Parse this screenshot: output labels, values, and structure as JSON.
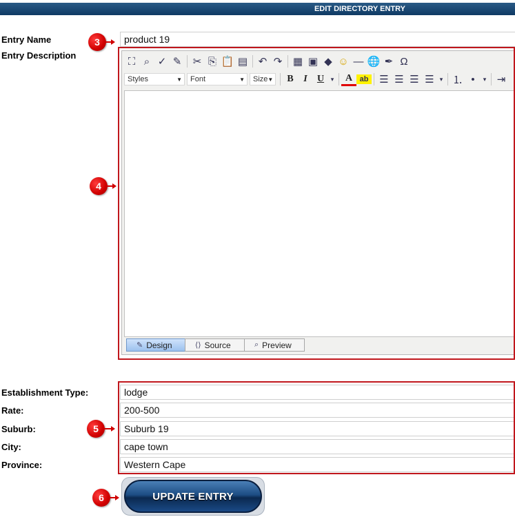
{
  "header": {
    "title": "EDIT DIRECTORY ENTRY"
  },
  "form": {
    "entry_name_label": "Entry Name",
    "entry_name_value": "product 19",
    "entry_description_label": "Entry Description",
    "establishment_type_label": "Establishment Type:",
    "establishment_type_value": "lodge",
    "rate_label": "Rate:",
    "rate_value": "200-500",
    "suburb_label": "Suburb:",
    "suburb_value": "Suburb 19",
    "city_label": "City:",
    "city_value": "cape town",
    "province_label": "Province:",
    "province_value": "Western Cape"
  },
  "editor": {
    "toolbar_row1_icons": [
      "fullscreen-icon",
      "find-icon",
      "spellcheck-icon",
      "clean-icon",
      "cut-icon",
      "copy-icon",
      "paste-icon",
      "paste-word-icon",
      "undo-icon",
      "redo-icon",
      "table-icon",
      "image-icon",
      "anchor-icon",
      "smiley-icon",
      "horizontal-rule-icon",
      "link-icon",
      "flash-icon",
      "special-char-icon"
    ],
    "styles_combo": "Styles",
    "font_combo": "Font",
    "size_combo": "Size",
    "bold": "B",
    "italic": "I",
    "underline": "U",
    "text_color": "A",
    "highlight": "ab",
    "special_char": "Ω",
    "tabs": [
      {
        "label": "Design",
        "active": true
      },
      {
        "label": "Source",
        "active": false
      },
      {
        "label": "Preview",
        "active": false
      }
    ]
  },
  "callouts": {
    "c3": "3",
    "c4": "4",
    "c5": "5",
    "c6": "6"
  },
  "colors": {
    "callout": "#d00000",
    "header": "#0f3a63",
    "highlight_box": "#c0161c"
  },
  "update_button": {
    "label": "UPDATE ENTRY"
  }
}
